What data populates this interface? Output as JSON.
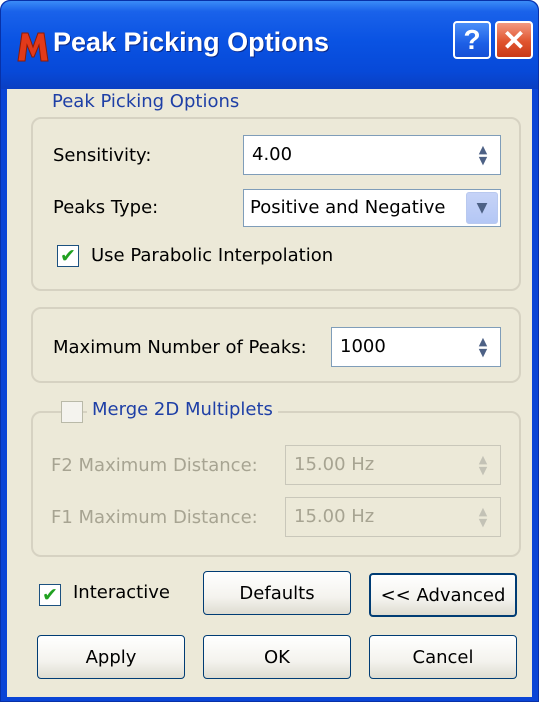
{
  "window": {
    "title": "Peak Picking Options",
    "help_label": "?",
    "close_label": "✕"
  },
  "peak_picking_group": {
    "legend": "Peak Picking Options",
    "sensitivity_label": "Sensitivity:",
    "sensitivity_value": "4.00",
    "peaks_type_label": "Peaks Type:",
    "peaks_type_value": "Positive and Negative",
    "parabolic_label": "Use Parabolic Interpolation",
    "parabolic_checked": true
  },
  "max_peaks_group": {
    "label": "Maximum Number of Peaks:",
    "value": "1000"
  },
  "merge_group": {
    "legend": "Merge 2D Multiplets",
    "merge_checked": false,
    "f2_label": "F2 Maximum Distance:",
    "f2_value": "15.00 Hz",
    "f1_label": "F1 Maximum Distance:",
    "f1_value": "15.00 Hz"
  },
  "footer": {
    "interactive_label": "Interactive",
    "interactive_checked": true,
    "defaults_label": "Defaults",
    "advanced_label": "<< Advanced",
    "apply_label": "Apply",
    "ok_label": "OK",
    "cancel_label": "Cancel"
  },
  "glyphs": {
    "check": "✔",
    "spin_up": "▲",
    "spin_down": "▼",
    "combo_down": "▼"
  },
  "colors": {
    "titlebar": "#0a53e3",
    "dialog_bg": "#ece9d8",
    "group_legend": "#1e3fa6",
    "checkmark": "#21a121",
    "disabled_text": "#a7a492"
  }
}
